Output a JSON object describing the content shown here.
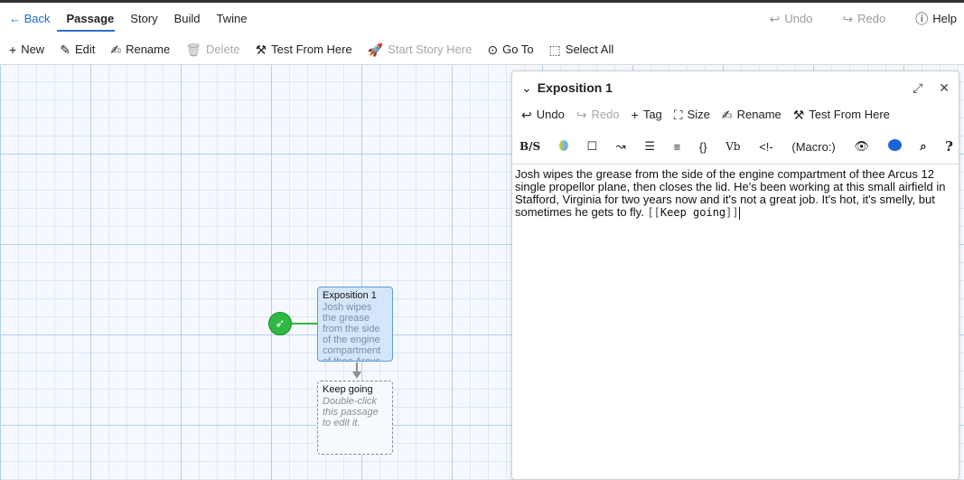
{
  "topbar": {
    "back_label": "← Back",
    "tabs": [
      "Passage",
      "Story",
      "Build",
      "Twine"
    ],
    "undo_label": "Undo",
    "redo_label": "Redo",
    "help_label": "Help"
  },
  "toolbar": {
    "new_label": "New",
    "edit_label": "Edit",
    "rename_label": "Rename",
    "delete_label": "Delete",
    "test_from_here_label": "Test From Here",
    "start_story_here_label": "Start Story Here",
    "go_to_label": "Go To",
    "select_all_label": "Select All"
  },
  "passages": [
    {
      "title": "Exposition 1",
      "excerpt": "Josh wipes the grease from the side of the engine compartment of thee Arcus"
    },
    {
      "title": "Keep going",
      "excerpt": "Double-click this passage to edit it."
    }
  ],
  "dialog": {
    "title": "Exposition 1",
    "toolbar": {
      "undo_label": "Undo",
      "redo_label": "Redo",
      "tag_label": "Tag",
      "size_label": "Size",
      "rename_label": "Rename",
      "test_label": "Test From Here"
    },
    "format_toolbar": {
      "bs_label": "B/S",
      "braces_label": "{}",
      "vb_label": "Vb",
      "comment_label": "<!-",
      "macro_label": "(Macro:)",
      "help_label": "?"
    },
    "text_body": "Josh wipes the grease from the side of the engine compartment of thee Arcus 12 single propellor plane, then closes the lid. He's been working at this small airfield in Stafford, Virginia for two years now and it's not a great job. It's hot, it's smelly, but sometimes he gets to fly. ",
    "link_open": "[[",
    "link_text": "Keep going",
    "link_close": "]]"
  },
  "colors": {
    "accent": "#2b6fd1",
    "start_badge": "#2fb842",
    "selected_passage_bg": "#d5e6fb",
    "grid_bg": "#f5f9ff"
  }
}
